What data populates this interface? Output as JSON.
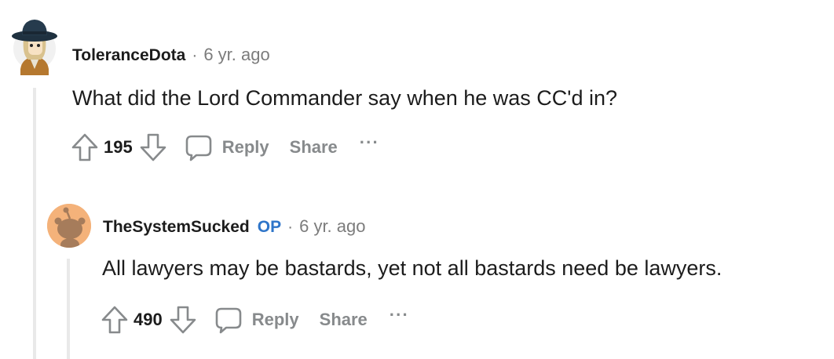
{
  "comments": [
    {
      "username": "ToleranceDota",
      "separator": "·",
      "time": "6 yr. ago",
      "body": "What did the Lord Commander say when he was CC'd in?",
      "votes": "195",
      "reply_label": "Reply",
      "share_label": "Share",
      "more_label": "···"
    },
    {
      "username": "TheSystemSucked",
      "op_badge": "OP",
      "separator": "·",
      "time": "6 yr. ago",
      "body": "All lawyers may be bastards, yet not all bastards need be lawyers.",
      "votes": "490",
      "reply_label": "Reply",
      "share_label": "Share",
      "more_label": "···"
    }
  ],
  "colors": {
    "op_badge": "#2e75c9",
    "muted": "#7c7c7c",
    "thread_line": "#e9e9e9",
    "avatar2_bg": "#f4b27a"
  },
  "icons": [
    "avatar-hat-character-icon",
    "upvote-arrow-icon",
    "downvote-arrow-icon",
    "comment-bubble-icon",
    "snoo-avatar-icon"
  ]
}
